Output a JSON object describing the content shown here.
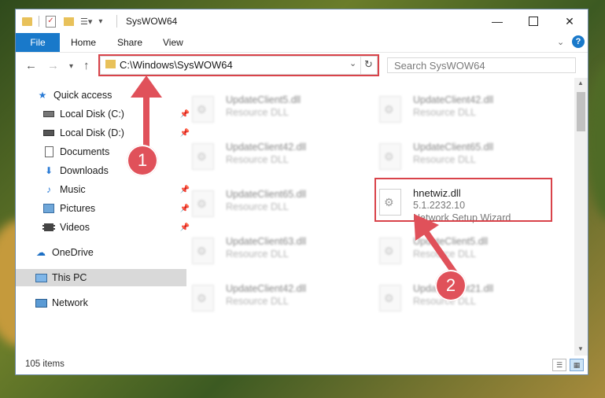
{
  "window": {
    "title": "SysWOW64"
  },
  "ribbon": {
    "file": "File",
    "tabs": [
      "Home",
      "Share",
      "View"
    ]
  },
  "address": {
    "path": "C:\\Windows\\SysWOW64"
  },
  "search": {
    "placeholder": "Search SysWOW64"
  },
  "sidebar": {
    "items": [
      {
        "label": "Quick access",
        "icon": "star-icon"
      },
      {
        "label": "Local Disk (C:)",
        "icon": "drive-icon"
      },
      {
        "label": "Local Disk (D:)",
        "icon": "drive-icon"
      },
      {
        "label": "Documents",
        "icon": "document-icon"
      },
      {
        "label": "Downloads",
        "icon": "download-icon"
      },
      {
        "label": "Music",
        "icon": "music-icon"
      },
      {
        "label": "Pictures",
        "icon": "pictures-icon"
      },
      {
        "label": "Videos",
        "icon": "video-icon"
      },
      {
        "label": "OneDrive",
        "icon": "cloud-icon"
      },
      {
        "label": "This PC",
        "icon": "computer-icon"
      },
      {
        "label": "Network",
        "icon": "network-icon"
      }
    ]
  },
  "files": {
    "left": [
      {
        "name": "UpdateClient5.dll",
        "type": "Resource DLL"
      },
      {
        "name": "UpdateClient42.dll",
        "type": "Resource DLL"
      },
      {
        "name": "UpdateClient65.dll",
        "type": "Resource DLL"
      },
      {
        "name": "UpdateClient63.dll",
        "type": "Resource DLL"
      },
      {
        "name": "UpdateClient42.dll",
        "type": "Resource DLL"
      }
    ],
    "right": [
      {
        "name": "UpdateClient42.dll",
        "type": "Resource DLL"
      },
      {
        "name": "UpdateClient65.dll",
        "type": "Resource DLL"
      },
      {
        "name": "UpdateClient5.dll",
        "type": "Resource DLL"
      },
      {
        "name": "UpdateClient21.dll",
        "type": "Resource DLL"
      }
    ],
    "highlighted": {
      "name": "hnetwiz.dll",
      "version": "5.1.2232.10",
      "description": "Network Setup Wizard"
    }
  },
  "status": {
    "items": "105 items"
  },
  "annotations": {
    "step1": "1",
    "step2": "2"
  },
  "colors": {
    "accent": "#1979ca",
    "highlight": "#d9434a"
  }
}
